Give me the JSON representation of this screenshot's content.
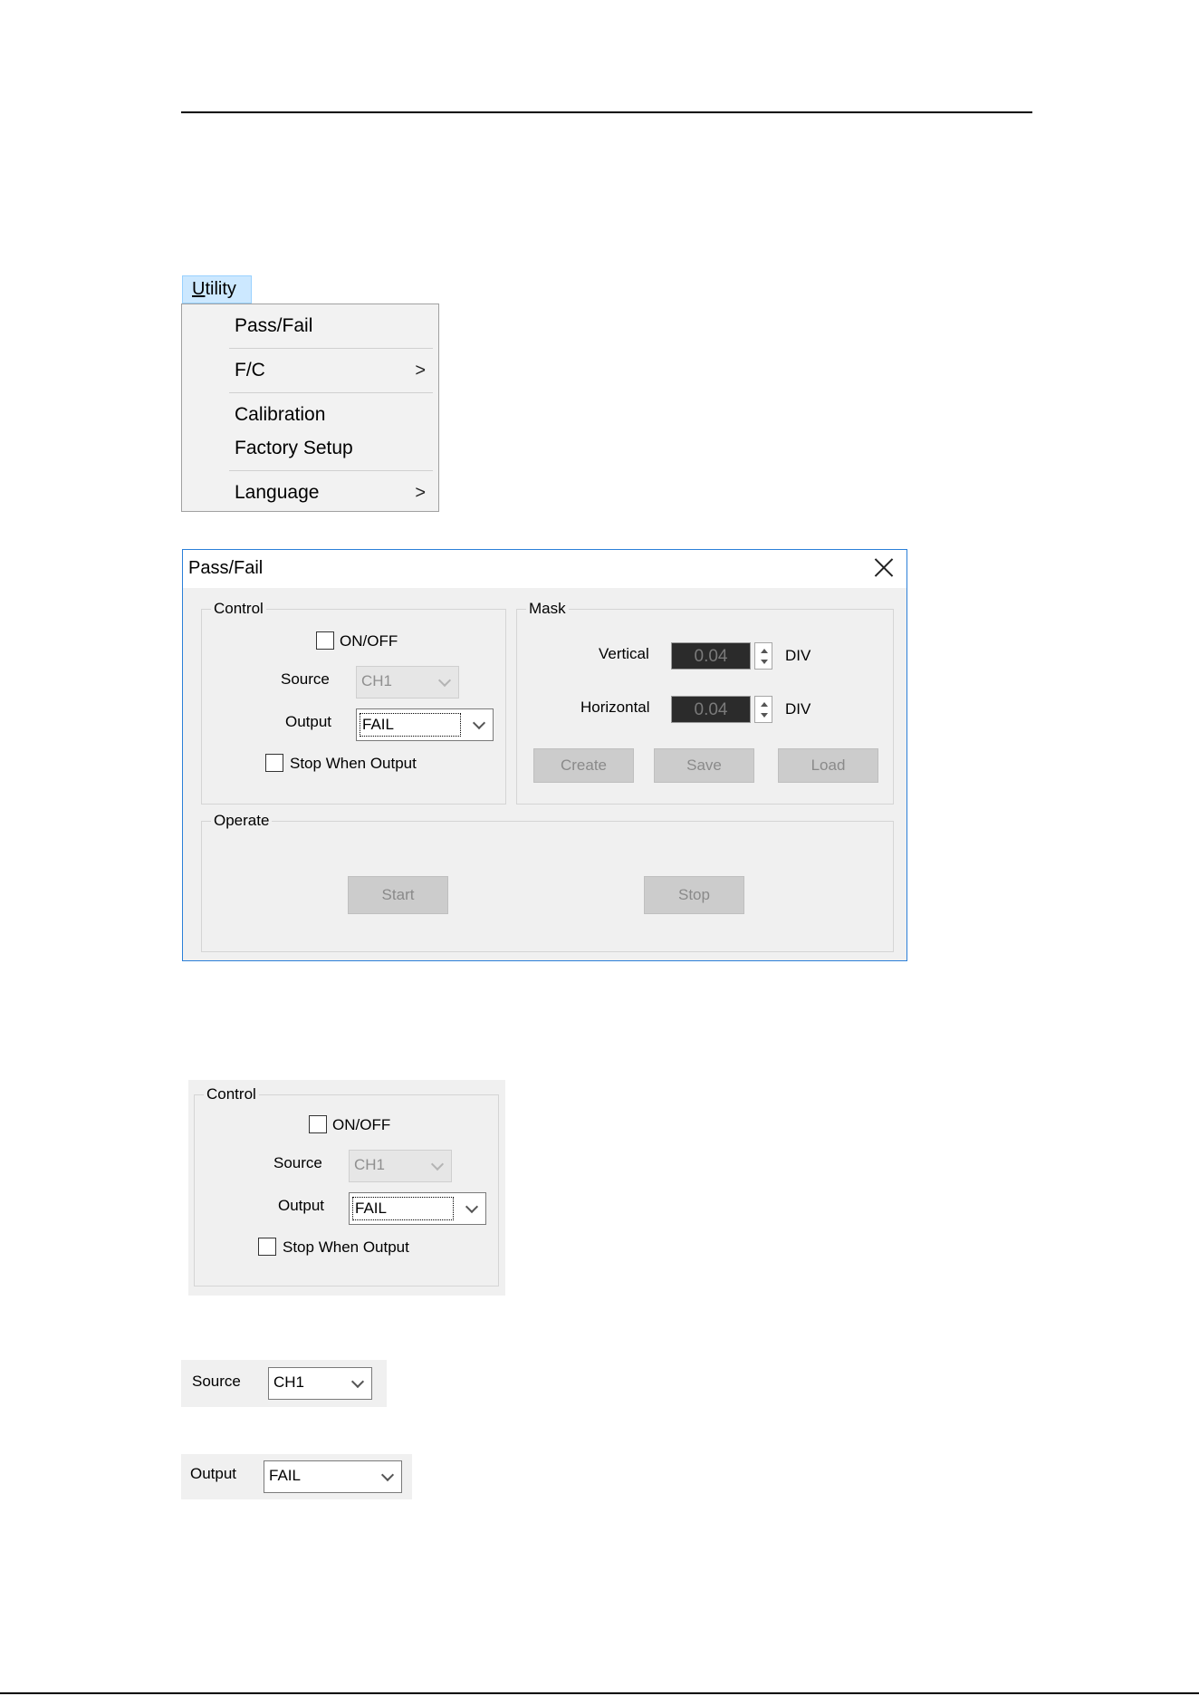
{
  "menu": {
    "title_underlined": "U",
    "title_rest": "tility",
    "items": [
      {
        "label": "Pass/Fail",
        "submenu": false
      },
      {
        "label": "F/C",
        "submenu": true
      },
      {
        "label": "Calibration",
        "submenu": false
      },
      {
        "label": "Factory Setup",
        "submenu": false
      },
      {
        "label": "Language",
        "submenu": true
      }
    ],
    "submenu_arrow": ">"
  },
  "dialog": {
    "title": "Pass/Fail",
    "control": {
      "label": "Control",
      "onoff_label": "ON/OFF",
      "source_label": "Source",
      "source_value": "CH1",
      "output_label": "Output",
      "output_value": "FAIL",
      "stop_when_output_label": "Stop When Output"
    },
    "mask": {
      "label": "Mask",
      "vertical_label": "Vertical",
      "vertical_value": "0.04",
      "vertical_unit": "DIV",
      "horizontal_label": "Horizontal",
      "horizontal_value": "0.04",
      "horizontal_unit": "DIV",
      "create_label": "Create",
      "save_label": "Save",
      "load_label": "Load"
    },
    "operate": {
      "label": "Operate",
      "start_label": "Start",
      "stop_label": "Stop"
    }
  },
  "control_crop": {
    "label": "Control",
    "onoff_label": "ON/OFF",
    "source_label": "Source",
    "source_value": "CH1",
    "output_label": "Output",
    "output_value": "FAIL",
    "stop_when_output_label": "Stop When Output"
  },
  "source_crop": {
    "label": "Source",
    "value": "CH1"
  },
  "output_crop": {
    "label": "Output",
    "value": "FAIL"
  }
}
